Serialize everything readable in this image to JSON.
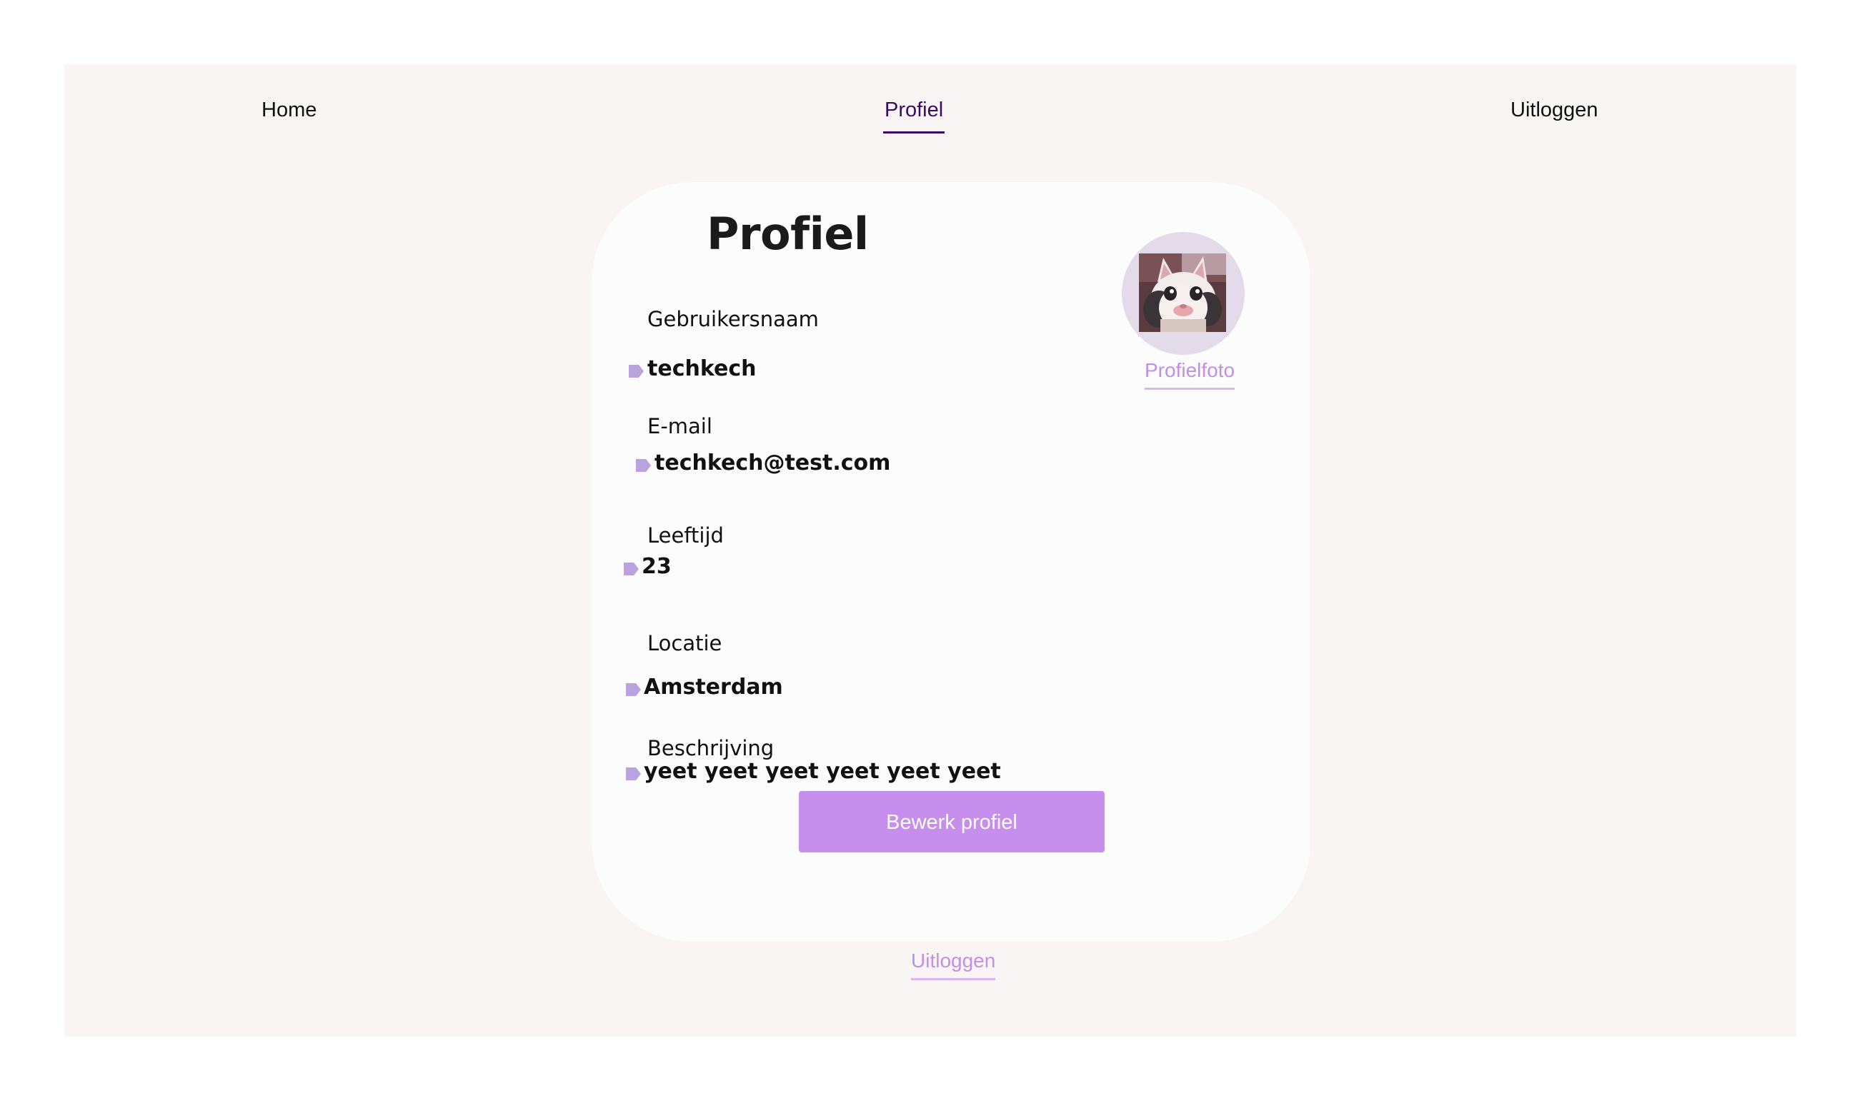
{
  "nav": {
    "home": "Home",
    "profile": "Profiel",
    "logout": "Uitloggen"
  },
  "card": {
    "title": "Profiel",
    "fields": [
      {
        "label": "Gebruikersnaam",
        "value": "techkech"
      },
      {
        "label": "E-mail",
        "value": "techkech@test.com"
      },
      {
        "label": "Leeftijd",
        "value": "23"
      },
      {
        "label": "Locatie",
        "value": "Amsterdam"
      },
      {
        "label": "Beschrijving",
        "value": "yeet yeet yeet yeet yeet yeet"
      }
    ],
    "avatar_link": "Profielfoto",
    "edit_button": "Bewerk profiel"
  },
  "footer": {
    "logout_link": "Uitloggen"
  },
  "colors": {
    "accent": "#c68eed",
    "nav_active": "#3b0a63",
    "link": "#c38fe6",
    "bullet": "#b9a2de"
  },
  "icons": {
    "bullet": "arrow-tag-icon",
    "avatar": "cat-avatar-image"
  }
}
